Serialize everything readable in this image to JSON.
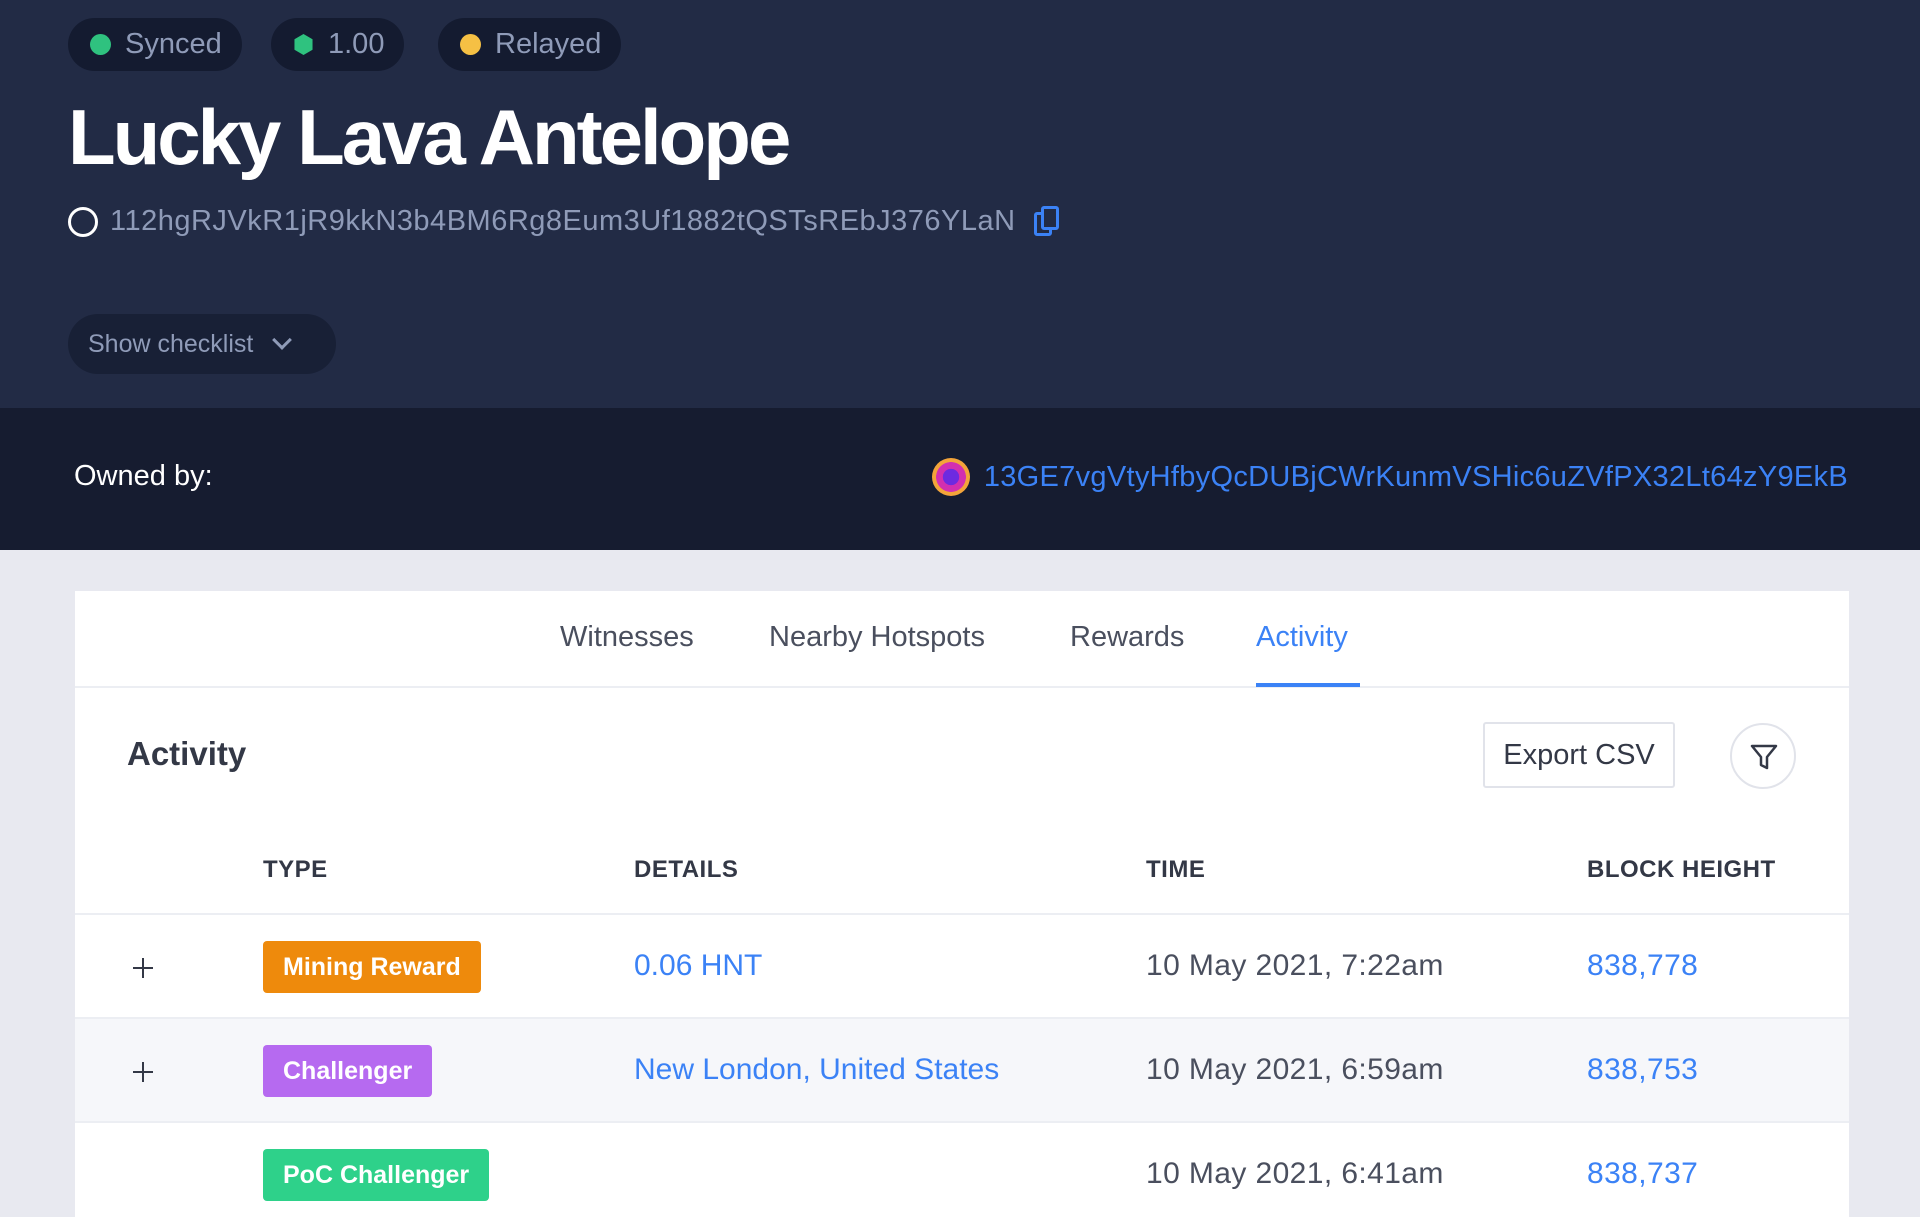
{
  "status": {
    "synced_label": "Synced",
    "synced_color": "#2fc27f",
    "scale_value": "1.00",
    "scale_color": "#2fc27f",
    "relay_label": "Relayed",
    "relay_color": "#f5c044"
  },
  "hotspot": {
    "name": "Lucky Lava Antelope",
    "address": "112hgRJVkR1jR9kkN3b4BM6Rg8Eum3Uf1882tQSTsREbJ376YLaN"
  },
  "checklist_button": "Show checklist",
  "owner": {
    "label": "Owned by:",
    "address": "13GE7vgVtyHfbyQcDUBjCWrKunmVSHic6uZVfPX32Lt64zY9EkB"
  },
  "tabs": [
    "Witnesses",
    "Nearby Hotspots",
    "Rewards",
    "Activity"
  ],
  "active_tab": "Activity",
  "activity": {
    "title": "Activity",
    "export_label": "Export CSV",
    "columns": [
      "TYPE",
      "DETAILS",
      "TIME",
      "BLOCK HEIGHT"
    ],
    "rows": [
      {
        "type": "Mining Reward",
        "type_color": "#ee8a0c",
        "details": "0.06 HNT",
        "time": "10 May 2021, 7:22am",
        "block": "838,778",
        "expandable": true
      },
      {
        "type": "Challenger",
        "type_color": "#b66af0",
        "details": "New London, United States",
        "time": "10 May 2021, 6:59am",
        "block": "838,753",
        "expandable": true
      },
      {
        "type": "PoC Challenger",
        "type_color": "#2ed18a",
        "details": "",
        "time": "10 May 2021, 6:41am",
        "block": "838,737",
        "expandable": false
      }
    ]
  },
  "colors": {
    "hero_bg": "#222b45",
    "owner_bg": "#161c30",
    "accent": "#3b82f6"
  }
}
